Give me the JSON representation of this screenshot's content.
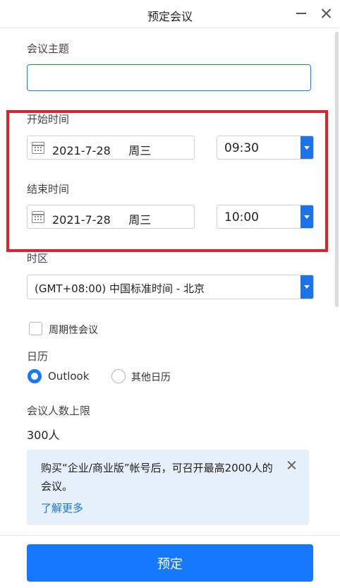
{
  "window": {
    "title": "预定会议"
  },
  "subject": {
    "label": "会议主题",
    "value": "",
    "placeholder": ""
  },
  "start": {
    "label": "开始时间",
    "date": "2021-7-28     周三",
    "time": "09:30"
  },
  "end": {
    "label": "结束时间",
    "date": "2021-7-28     周三",
    "time": "10:00"
  },
  "timezone": {
    "label": "时区",
    "value": "(GMT+08:00) 中国标准时间 - 北京"
  },
  "recurring": {
    "label": "周期性会议",
    "checked": false
  },
  "calendar": {
    "label": "日历",
    "options": [
      {
        "label": "Outlook",
        "selected": true
      },
      {
        "label": "其他日历",
        "selected": false
      }
    ]
  },
  "capacity": {
    "label": "会议人数上限",
    "value": "300人"
  },
  "notice": {
    "text": "购买“企业/商业版”帐号后，可召开最高2000人的会议。",
    "link": "了解更多"
  },
  "submit": {
    "label": "预定"
  },
  "colors": {
    "accent": "#1677ff",
    "highlight": "#e0202a",
    "notice_bg": "#e6f0fb"
  },
  "icons": {
    "calendar": "calendar-icon",
    "dropdown": "chevron-down-icon",
    "close": "close-icon",
    "minimize": "minimize-icon"
  }
}
